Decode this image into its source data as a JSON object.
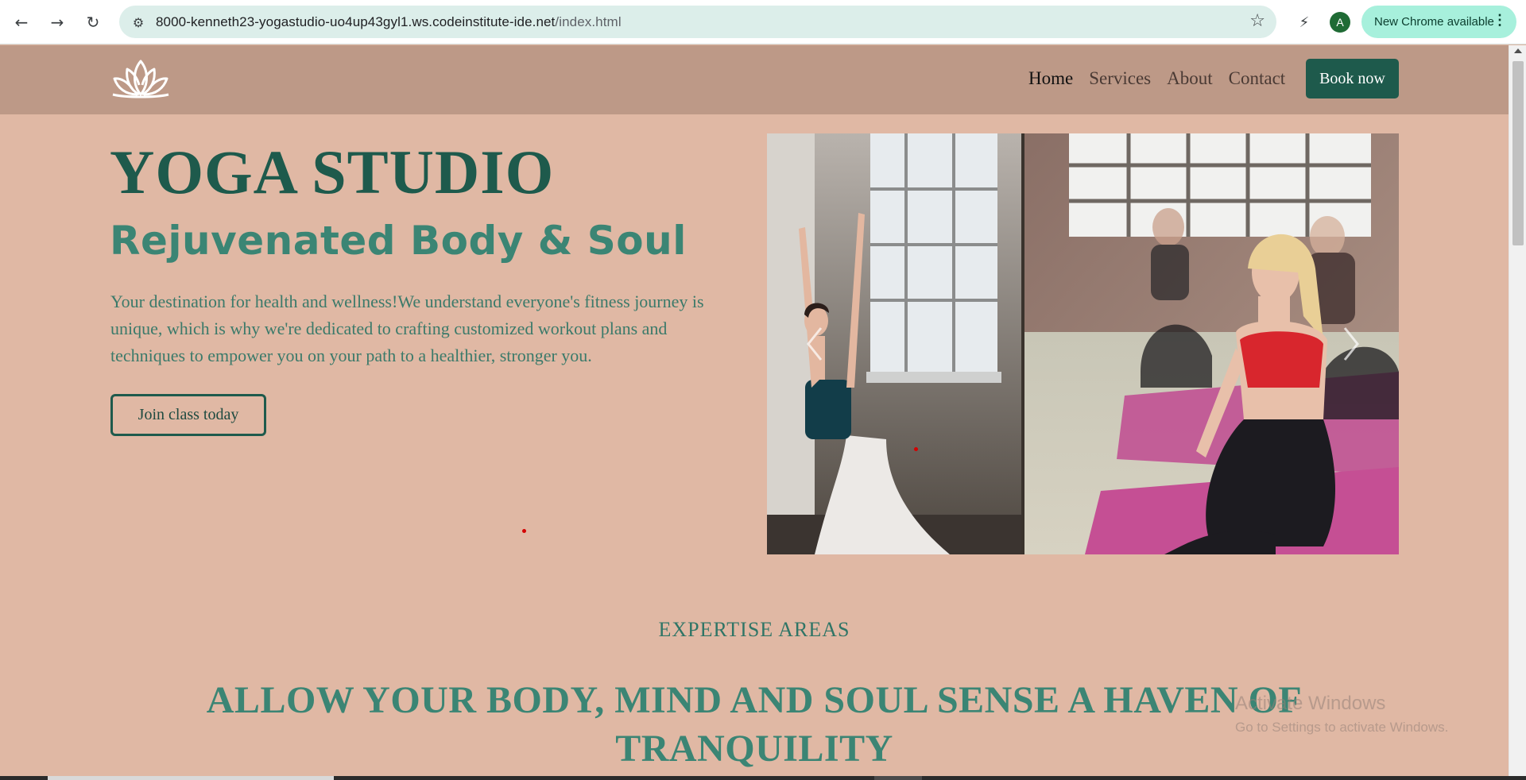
{
  "browser": {
    "back_icon": "←",
    "forward_icon": "→",
    "reload_icon": "↻",
    "site_info_icon": "⚙",
    "url_host": "8000-kenneth23-yogastudio-uo4up43gyl1.ws.codeinstitute-ide.net",
    "url_path": "/index.html",
    "star_icon": "☆",
    "extension_icon": "⚡",
    "profile_initial": "A",
    "update_label": "New Chrome available",
    "menu_icon": "⋮"
  },
  "header": {
    "logo_name": "lotus-logo",
    "nav": [
      "Home",
      "Services",
      "About",
      "Contact"
    ],
    "active_nav": "Home",
    "book_label": "Book now"
  },
  "hero": {
    "title": "YOGA STUDIO",
    "subtitle": "Rejuvenated Body & Soul",
    "text": "Your destination for health and wellness!We understand everyone's fitness journey is unique, which is why we're dedicated to crafting customized workout plans and techniques to empower you on your path to a healthier, stronger you.",
    "cta_label": "Join class today"
  },
  "carousel": {
    "prev_icon": "chevron-left",
    "next_icon": "chevron-right"
  },
  "expertise": {
    "eyebrow": "EXPERTISE AREAS",
    "heading": "ALLOW YOUR BODY, MIND AND SOUL SENSE A HAVEN OF TRANQUILITY"
  },
  "watermark": {
    "title": "Activate Windows",
    "subtitle": "Go to Settings to activate Windows."
  },
  "colors": {
    "page_bg": "#e0b8a4",
    "header_bg": "#bd9987",
    "accent_dark_green": "#1e5a4c",
    "accent_green": "#3b8574"
  }
}
